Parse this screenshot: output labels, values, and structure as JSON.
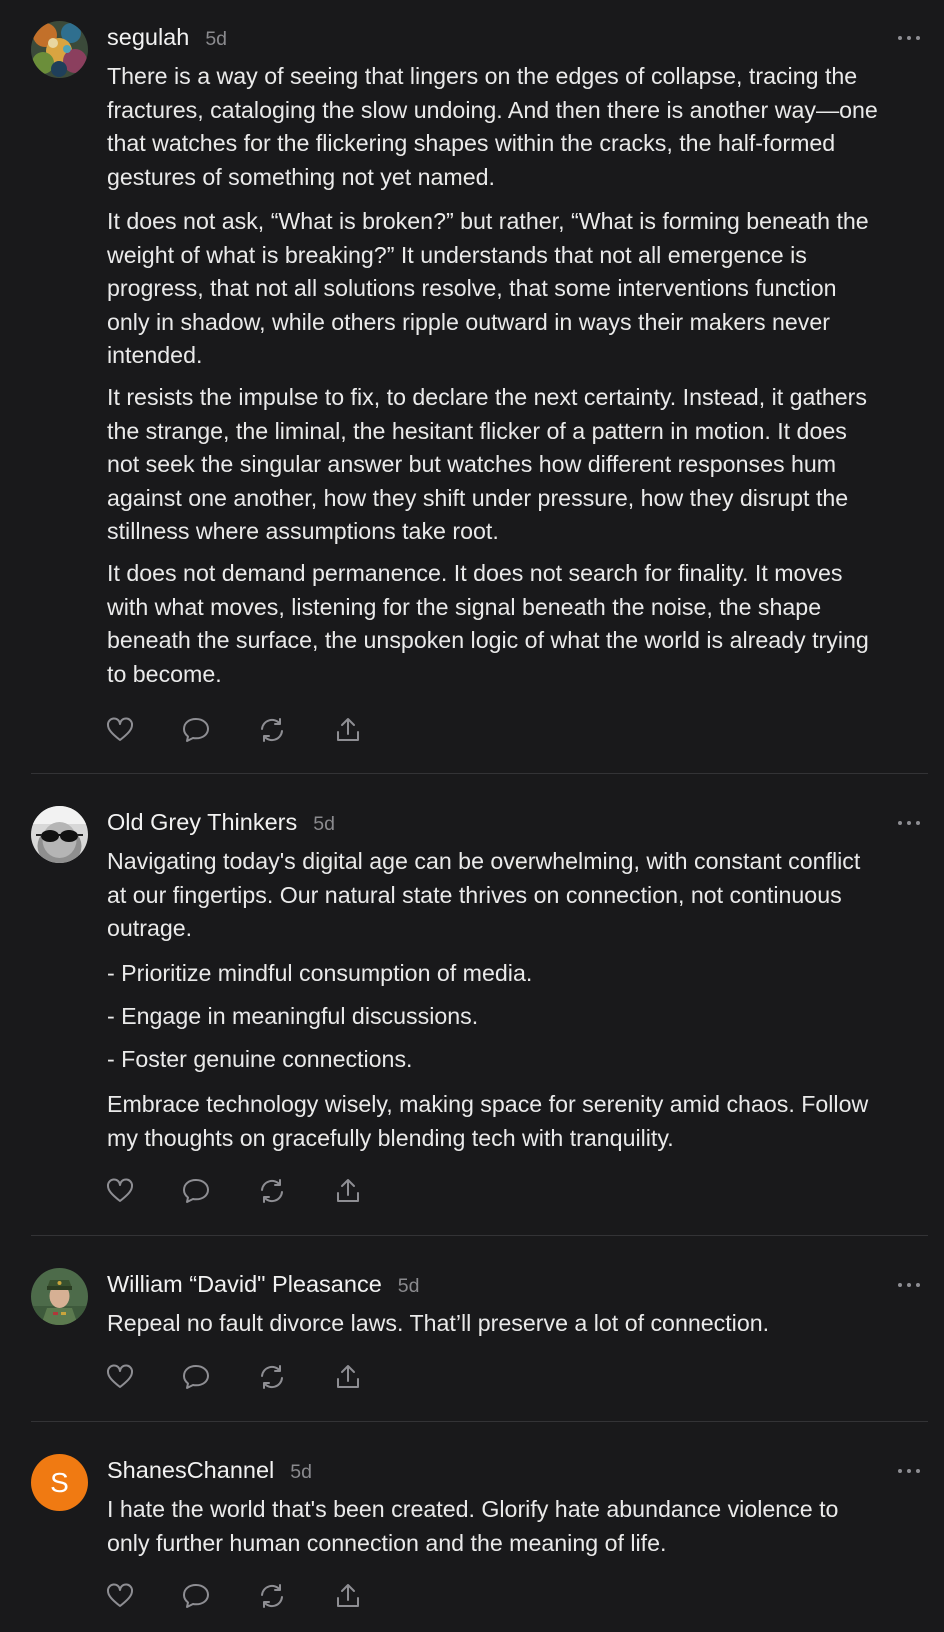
{
  "posts": [
    {
      "author": "segulah",
      "time": "5d",
      "avatar": "mosaic-avatar",
      "paragraphs": [
        "There is a way of seeing that lingers on the edges of collapse, tracing the\nfractures, cataloging the slow undoing. And then there is another way—one\nthat watches for the flickering shapes within the cracks, the half-formed\ngestures of something not yet named.",
        "It does not ask, “What is broken?” but rather, “What is forming beneath the\nweight of what is breaking?” It understands that not all emergence is\nprogress, that not all solutions resolve, that some interventions function\nonly in shadow, while others ripple outward in ways their makers never\nintended.",
        "It resists the impulse to fix, to declare the next certainty. Instead, it gathers\nthe strange, the liminal, the hesitant flicker of a pattern in motion. It does\nnot seek the singular answer but watches how different responses hum\nagainst one another, how they shift under pressure, how they disrupt the\nstillness where assumptions take root.",
        "It does not demand permanence. It does not search for finality. It moves\nwith what moves, listening for the signal beneath the noise, the shape\nbeneath the surface, the unspoken logic of what the world is already trying\nto become."
      ]
    },
    {
      "author": "Old Grey Thinkers",
      "time": "5d",
      "avatar": "sunglasses-avatar",
      "paragraphs": [
        "Navigating today's digital age can be overwhelming, with constant conflict\nat our fingertips. Our natural state thrives on connection, not continuous\noutrage.",
        "- Prioritize mindful consumption of media.",
        "- Engage in meaningful discussions.",
        "- Foster genuine connections.",
        "Embrace technology wisely, making space for serenity amid chaos. Follow\nmy thoughts on gracefully blending tech with tranquility."
      ]
    },
    {
      "author": "William “David\" Pleasance",
      "time": "5d",
      "avatar": "uniform-avatar",
      "paragraphs": [
        "Repeal no fault divorce laws. That’ll preserve a lot of connection."
      ]
    },
    {
      "author": "ShanesChannel",
      "time": "5d",
      "avatar": "letter-avatar",
      "avatar_letter": "S",
      "avatar_color": "#f07a12",
      "paragraphs": [
        "I hate the world that's been created. Glorify hate abundance violence to\nonly further human connection and the meaning of life."
      ]
    }
  ],
  "actions": [
    "heart-icon",
    "comment-icon",
    "restack-icon",
    "share-icon"
  ],
  "colors": {
    "background": "#19191b",
    "text": "#eaeaea",
    "muted": "#8a8a8e",
    "divider": "#333336",
    "icon": "#8e8e93"
  }
}
